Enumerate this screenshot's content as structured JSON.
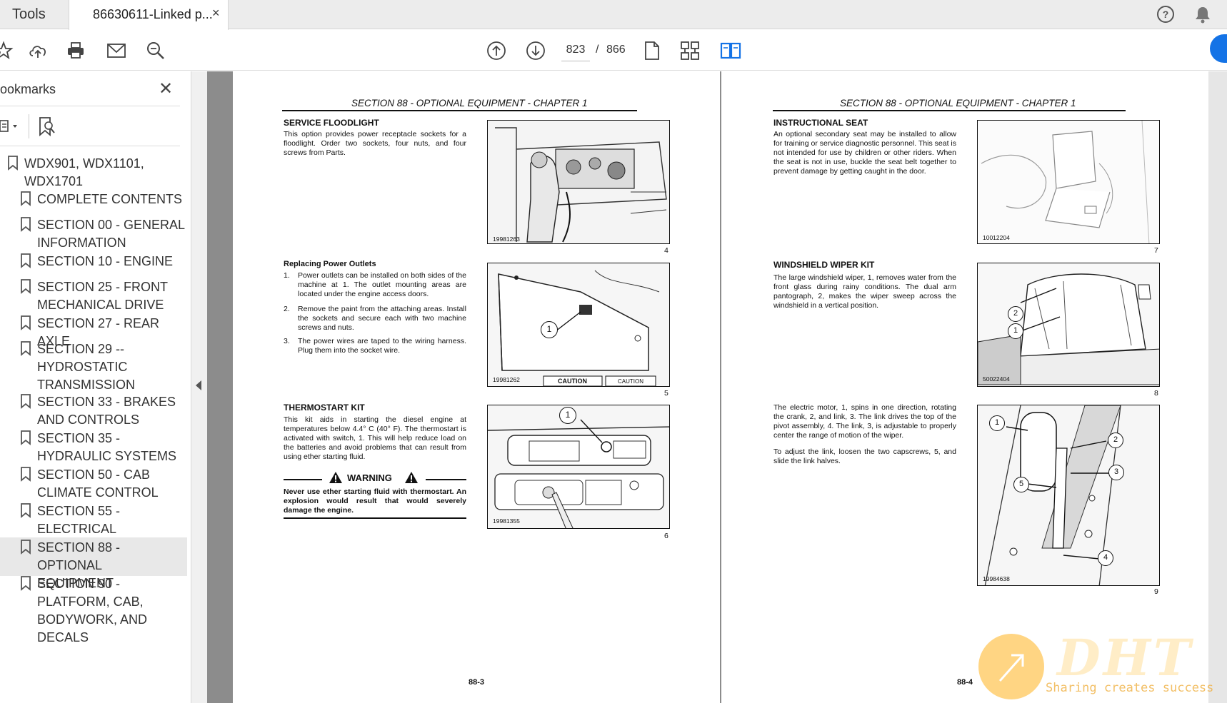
{
  "tabs": {
    "tools_label": "Tools",
    "document_label": "86630611-Linked p...",
    "close_symbol": "×"
  },
  "toolbar": {
    "current_page": "823",
    "separator": "/",
    "total_pages": "866",
    "accent_color": "#1473e6"
  },
  "sidebar": {
    "title": "ookmarks",
    "close_symbol": "✕",
    "bookmarks": [
      {
        "label_lines": [
          "WDX901, WDX1101,",
          "WDX1701"
        ]
      },
      {
        "label_lines": [
          "COMPLETE CONTENTS"
        ]
      },
      {
        "label_lines": [
          "SECTION 00 - GENERAL",
          "INFORMATION"
        ]
      },
      {
        "label_lines": [
          "SECTION 10 - ENGINE"
        ]
      },
      {
        "label_lines": [
          "SECTION 25 - FRONT",
          "MECHANICAL DRIVE"
        ]
      },
      {
        "label_lines": [
          "SECTION 27 - REAR AXLE"
        ]
      },
      {
        "label_lines": [
          "SECTION 29 --",
          "HYDROSTATIC",
          "TRANSMISSION"
        ]
      },
      {
        "label_lines": [
          "SECTION 33 - BRAKES",
          "AND CONTROLS"
        ]
      },
      {
        "label_lines": [
          "SECTION 35 -",
          "HYDRAULIC SYSTEMS"
        ]
      },
      {
        "label_lines": [
          "SECTION 50 - CAB",
          "CLIMATE CONTROL"
        ]
      },
      {
        "label_lines": [
          "SECTION 55 -",
          "ELECTRICAL"
        ]
      },
      {
        "label_lines": [
          "SECTION 88 - OPTIONAL",
          "EQUIPMENT"
        ],
        "active": true
      },
      {
        "label_lines": [
          "SECTION 90 -",
          "PLATFORM, CAB,",
          "BODYWORK, AND",
          "DECALS"
        ]
      }
    ]
  },
  "left_page": {
    "section_header": "SECTION 88 - OPTIONAL EQUIPMENT - CHAPTER 1",
    "floodlight_title": "SERVICE FLOODLIGHT",
    "floodlight_text": "This option provides power receptacle sockets for a floodlight. Order two sockets, four nuts, and four screws from Parts.",
    "fig4_code": "19981263",
    "fig4_num": "4",
    "outlets_title": "Replacing Power Outlets",
    "outlets_steps": [
      {
        "n": "1.",
        "text": "Power outlets can be installed on both sides of the machine at 1. The outlet mounting areas are located under the engine access doors."
      },
      {
        "n": "2.",
        "text": "Remove the paint from the attaching areas. Install the sockets and secure each with two machine screws and nuts."
      },
      {
        "n": "3.",
        "text": "The power wires are taped to the wiring harness. Plug them into the socket wire."
      }
    ],
    "fig5_code": "19981262",
    "fig5_num": "5",
    "fig5_caution": "CAUTION",
    "fig5_callout": "1",
    "thermo_title": "THERMOSTART KIT",
    "thermo_text": "This kit aids in starting the diesel engine at temperatures below 4.4° C (40° F). The thermostart is activated with switch, 1. This will help reduce load on the batteries and avoid problems that can result from using ether starting fluid.",
    "warning_label": "WARNING",
    "warning_text": "Never use ether starting fluid with thermostart. An explosion would result that would severely damage the engine.",
    "fig6_code": "19981355",
    "fig6_num": "6",
    "fig6_callout": "1",
    "page_number": "88-3"
  },
  "right_page": {
    "section_header": "SECTION 88 - OPTIONAL EQUIPMENT - CHAPTER 1",
    "seat_title": "INSTRUCTIONAL SEAT",
    "seat_text": "An optional secondary seat may be installed to allow for training or service diagnostic personnel. This seat is not intended for use by children or other riders. When the seat is not in use, buckle the seat belt together to prevent damage by getting caught in the door.",
    "fig7_code": "10012204",
    "fig7_num": "7",
    "wiper_title": "WINDSHIELD WIPER KIT",
    "wiper_text": "The large windshield wiper, 1, removes water from the front glass during rainy conditions. The dual arm pantograph, 2, makes the wiper sweep across the windshield in a vertical position.",
    "fig8_code": "50022404",
    "fig8_num": "8",
    "fig8_callouts": [
      "2",
      "1"
    ],
    "motor_text": "The electric motor, 1, spins in one direction, rotating the crank, 2, and link, 3. The link drives the top of the pivot assembly, 4. The link, 3, is adjustable to properly center the range of motion of the wiper.",
    "adjust_text": "To adjust the link, loosen the two capscrews, 5, and slide the link halves.",
    "fig9_code": "19984638",
    "fig9_num": "9",
    "fig9_callouts": [
      "1",
      "2",
      "3",
      "5",
      "4"
    ],
    "page_number": "88-4"
  },
  "watermark": {
    "logo": "DHT",
    "slogan": "Sharing creates success"
  }
}
